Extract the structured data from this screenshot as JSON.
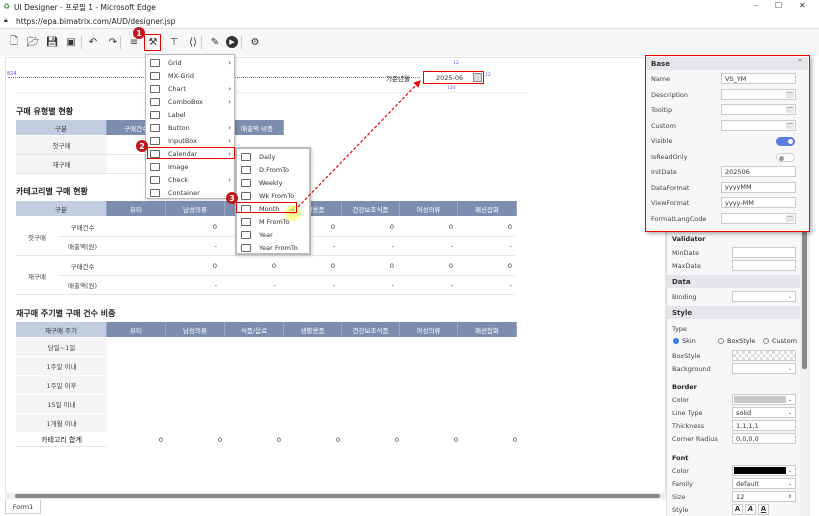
{
  "window": {
    "title": "UI Designer - 프로필 1 - Microsoft Edge",
    "url": "https://epa.bimatrix.com/AUD/designer.jsp"
  },
  "toolbar": {
    "icons": [
      "new-file-icon",
      "open-folder-icon",
      "save-icon",
      "save-all-icon",
      "undo-icon",
      "redo-icon",
      "database-icon",
      "tools-icon",
      "hierarchy-icon",
      "code-icon",
      "edit-icon",
      "play-icon",
      "gear-icon"
    ]
  },
  "badges": [
    "1",
    "2",
    "3"
  ],
  "canvas": {
    "ruler_label": "824",
    "date_field": {
      "label": "기준년월",
      "value": "2025-06",
      "dim_width": "120",
      "dim_height": "12"
    },
    "table1": {
      "title": "구매 유형별 현황",
      "headers": [
        "구분",
        "구매건수",
        "",
        "매출액 비중"
      ],
      "rows": [
        "첫구매",
        "재구매"
      ]
    },
    "table2": {
      "title": "카테고리별 구매 현황",
      "headers": [
        "구분",
        "뷰티",
        "남성의류",
        "식품/음료",
        "생활용품",
        "건강보조식품",
        "여성의류",
        "패션잡화"
      ],
      "groups": [
        {
          "label": "첫구매",
          "rows": [
            {
              "label": "구매건수",
              "values": [
                "0",
                "0",
                "0",
                "0",
                "0",
                "0"
              ]
            },
            {
              "label": "매출액(원)",
              "values": [
                "-",
                "-",
                "-",
                "-",
                "-",
                "-"
              ]
            }
          ]
        },
        {
          "label": "재구매",
          "rows": [
            {
              "label": "구매건수",
              "values": [
                "0",
                "0",
                "0",
                "0",
                "0",
                "0"
              ]
            },
            {
              "label": "매출액(원)",
              "values": [
                "-",
                "-",
                "-",
                "-",
                "-",
                "-"
              ]
            }
          ]
        }
      ]
    },
    "table3": {
      "title": "재구매 주기별 구매 건수 비중",
      "headers": [
        "재구매 주기",
        "뷰티",
        "남성의류",
        "식품/음료",
        "생활용품",
        "건강보조식품",
        "여성의류",
        "패션잡화"
      ],
      "rows": [
        "당일~1일",
        "1주일 이내",
        "1주일 이후",
        "15일 이내",
        "1개월 이내"
      ],
      "total": {
        "label": "카테고리 합계",
        "values": [
          "0",
          "0",
          "0",
          "0",
          "0",
          "0",
          "0"
        ]
      }
    }
  },
  "menu": {
    "items": [
      {
        "label": "Grid",
        "sub": true
      },
      {
        "label": "MX-Grid",
        "sub": false
      },
      {
        "label": "Chart",
        "sub": true
      },
      {
        "label": "ComboBox",
        "sub": true
      },
      {
        "label": "Label",
        "sub": false
      },
      {
        "label": "Button",
        "sub": true
      },
      {
        "label": "InputBox",
        "sub": true
      },
      {
        "label": "Calendar",
        "sub": true
      },
      {
        "label": "Image",
        "sub": false
      },
      {
        "label": "Check",
        "sub": true
      },
      {
        "label": "Container",
        "sub": false
      }
    ],
    "submenu": [
      "Daily",
      "D FromTo",
      "Weekly",
      "Wk FromTo",
      "Month",
      "M FromTo",
      "Year",
      "Year FromTo"
    ]
  },
  "props": {
    "base": {
      "title": "Base",
      "rows": [
        {
          "label": "Name",
          "value": "VS_YM",
          "kind": "text"
        },
        {
          "label": "Description",
          "value": "",
          "kind": "dots"
        },
        {
          "label": "Tooltip",
          "value": "",
          "kind": "dots"
        },
        {
          "label": "Custom",
          "value": "",
          "kind": "dots"
        },
        {
          "label": "Visible",
          "value": true,
          "kind": "toggle"
        },
        {
          "label": "IsReadOnly",
          "value": false,
          "kind": "toggle"
        },
        {
          "label": "InitDate",
          "value": "202506",
          "kind": "text"
        },
        {
          "label": "DataFormat",
          "value": "yyyyMM",
          "kind": "text"
        },
        {
          "label": "ViewFormat",
          "value": "yyyy-MM",
          "kind": "text"
        },
        {
          "label": "FormatLangCode",
          "value": "",
          "kind": "dots"
        }
      ]
    },
    "validator": {
      "title": "Validator",
      "rows": [
        {
          "label": "MinDate",
          "value": ""
        },
        {
          "label": "MaxDate",
          "value": ""
        }
      ]
    },
    "data": {
      "title": "Data",
      "binding_label": "Binding",
      "binding_value": ""
    },
    "style": {
      "title": "Style",
      "type_label": "Type",
      "types": [
        "Skin",
        "BoxStyle",
        "Custom"
      ],
      "selected_type": "Skin",
      "boxstyle_label": "BoxStyle",
      "background_label": "Background"
    },
    "border": {
      "title": "Border",
      "color_label": "Color",
      "color": "#c8c8c8",
      "linetype_label": "Line Type",
      "linetype": "solid",
      "thickness_label": "Thickness",
      "thickness": "1,1,1,1",
      "radius_label": "Corner Radius",
      "radius": "0,0,0,0"
    },
    "font": {
      "title": "Font",
      "color_label": "Color",
      "color": "#000000",
      "family_label": "Family",
      "family": "default",
      "size_label": "Size",
      "size": "12",
      "style_label": "Style",
      "style_buttons": [
        "A",
        "A",
        "A"
      ]
    }
  },
  "tabs": [
    "Form1"
  ],
  "colors": {
    "accent_red": "#e00000",
    "header_blue": "#7c8db0",
    "header_light": "#c2cde0",
    "toggle_on": "#5a7be0"
  }
}
